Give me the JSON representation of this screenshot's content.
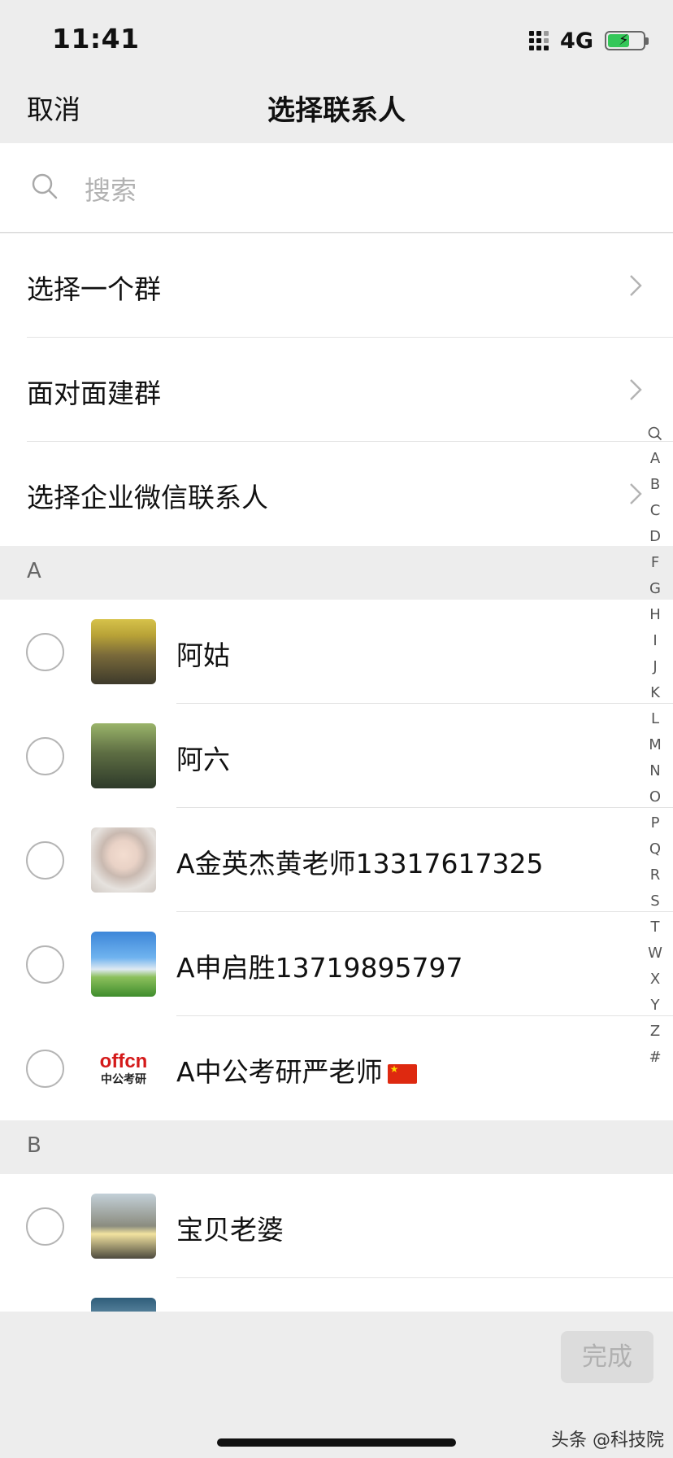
{
  "status_bar": {
    "time": "11:41",
    "network": "4G"
  },
  "nav": {
    "cancel": "取消",
    "title": "选择联系人"
  },
  "search": {
    "placeholder": "搜索"
  },
  "menu": [
    {
      "label": "选择一个群"
    },
    {
      "label": "面对面建群"
    },
    {
      "label": "选择企业微信联系人"
    }
  ],
  "sections": [
    {
      "letter": "A",
      "contacts": [
        {
          "name": "阿姑"
        },
        {
          "name": "阿六"
        },
        {
          "name": "A金英杰黄老师13317617325"
        },
        {
          "name": "A申启胜13719895797"
        },
        {
          "name": "A中公考研严老师"
        }
      ]
    },
    {
      "letter": "B",
      "contacts": [
        {
          "name": "宝贝老婆"
        }
      ]
    }
  ],
  "offcn_logo": {
    "brand": "offcn",
    "subtitle": "中公考研"
  },
  "index_letters": [
    "A",
    "B",
    "C",
    "D",
    "F",
    "G",
    "H",
    "I",
    "J",
    "K",
    "L",
    "M",
    "N",
    "O",
    "P",
    "Q",
    "R",
    "S",
    "T",
    "W",
    "X",
    "Y",
    "Z",
    "#"
  ],
  "done_button": "完成",
  "watermark": "头条 @科技院",
  "colors": {
    "background": "#ededed",
    "done_disabled": "#dcdcdc",
    "battery": "#34c759"
  }
}
